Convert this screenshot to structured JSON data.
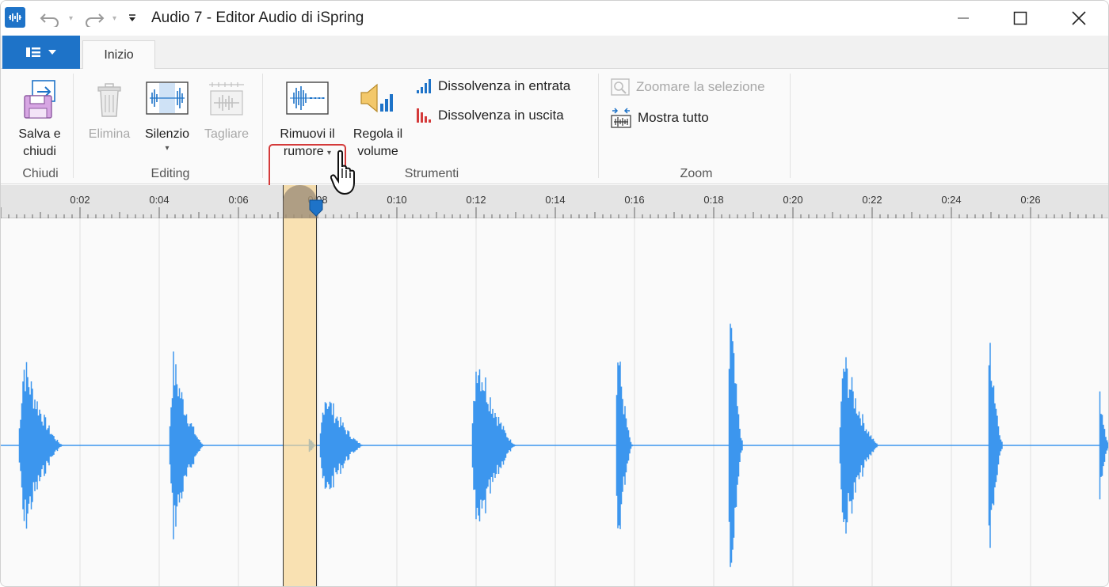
{
  "window": {
    "title": "Audio 7 - Editor Audio di iSpring"
  },
  "tabs": {
    "home_label": "Inizio"
  },
  "ribbon": {
    "groups": {
      "close": "Chiudi",
      "editing": "Editing",
      "tools": "Strumenti",
      "zoom": "Zoom"
    },
    "save_close": {
      "line1": "Salva e",
      "line2": "chiudi"
    },
    "delete": "Elimina",
    "silence": "Silenzio",
    "cut": "Tagliare",
    "remove_noise": {
      "line1": "Rimuovi il",
      "line2": "rumore"
    },
    "adjust_volume": {
      "line1": "Regola il",
      "line2": "volume"
    },
    "fade_in": "Dissolvenza in entrata",
    "fade_out": "Dissolvenza in uscita",
    "zoom_selection": "Zoomare la selezione",
    "show_all": "Mostra tutto"
  },
  "ruler": {
    "labels": [
      "0:02",
      "0:04",
      "0:06",
      "0:08",
      "0:10",
      "0:12",
      "0:14",
      "0:16",
      "0:18",
      "0:20",
      "0:22",
      "0:24",
      "0:26"
    ]
  },
  "colors": {
    "accent": "#1e73c8",
    "waveform": "#3c96ee",
    "selection": "#f9d48c",
    "highlight": "#d43a3a"
  }
}
